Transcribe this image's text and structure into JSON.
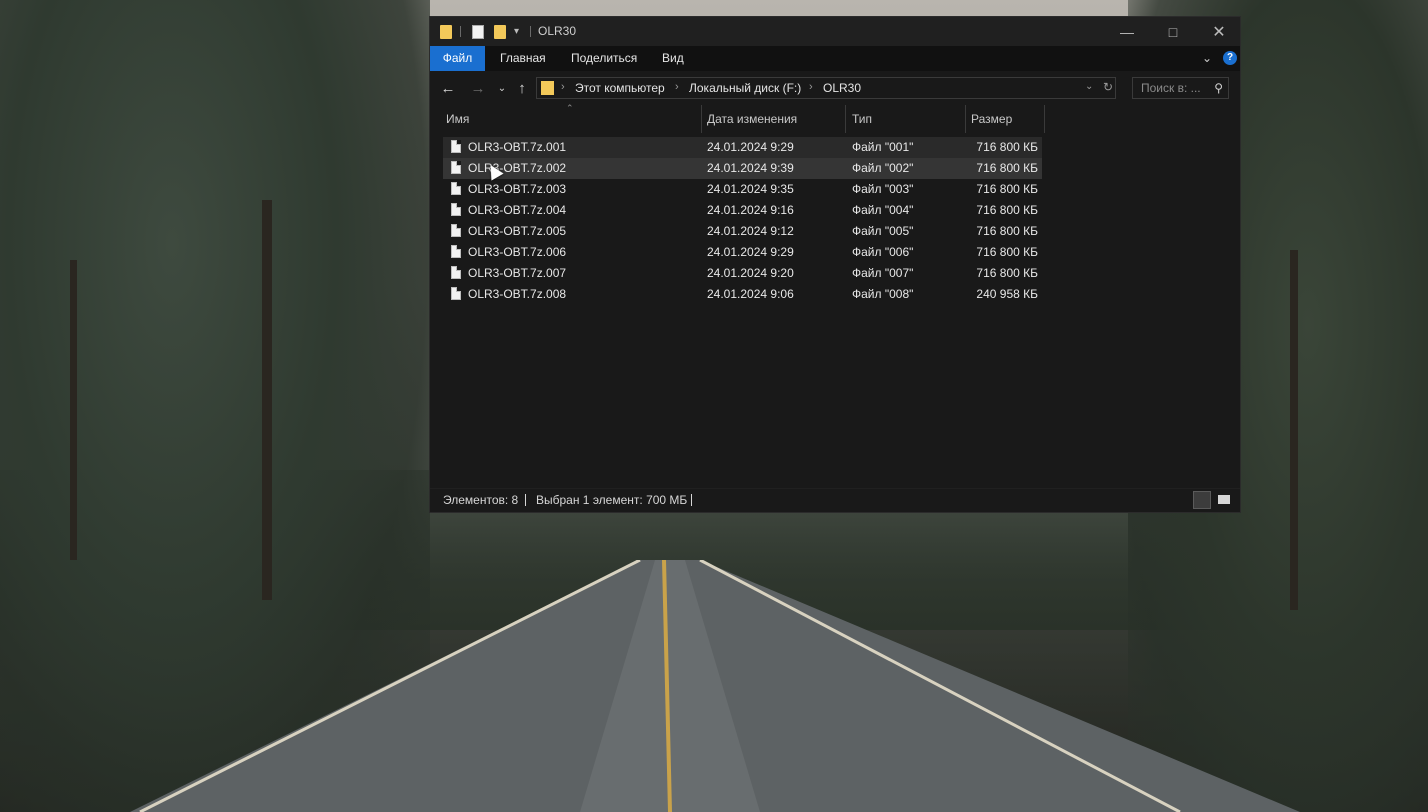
{
  "window": {
    "title": "OLR30",
    "menu": [
      "Файл",
      "Главная",
      "Поделиться",
      "Вид"
    ],
    "breadcrumb": [
      "Этот компьютер",
      "Локальный диск (F:)",
      "OLR30"
    ],
    "search_placeholder": "Поиск в: ...",
    "columns": {
      "name": "Имя",
      "date": "Дата изменения",
      "type": "Тип",
      "size": "Размер"
    },
    "files": [
      {
        "name": "OLR3-OBT.7z.001",
        "date": "24.01.2024 9:29",
        "type": "Файл \"001\"",
        "size": "716 800 КБ"
      },
      {
        "name": "OLR3-OBT.7z.002",
        "date": "24.01.2024 9:39",
        "type": "Файл \"002\"",
        "size": "716 800 КБ"
      },
      {
        "name": "OLR3-OBT.7z.003",
        "date": "24.01.2024 9:35",
        "type": "Файл \"003\"",
        "size": "716 800 КБ"
      },
      {
        "name": "OLR3-OBT.7z.004",
        "date": "24.01.2024 9:16",
        "type": "Файл \"004\"",
        "size": "716 800 КБ"
      },
      {
        "name": "OLR3-OBT.7z.005",
        "date": "24.01.2024 9:12",
        "type": "Файл \"005\"",
        "size": "716 800 КБ"
      },
      {
        "name": "OLR3-OBT.7z.006",
        "date": "24.01.2024 9:29",
        "type": "Файл \"006\"",
        "size": "716 800 КБ"
      },
      {
        "name": "OLR3-OBT.7z.007",
        "date": "24.01.2024 9:20",
        "type": "Файл \"007\"",
        "size": "716 800 КБ"
      },
      {
        "name": "OLR3-OBT.7z.008",
        "date": "24.01.2024 9:06",
        "type": "Файл \"008\"",
        "size": "240 958 КБ"
      }
    ],
    "status": {
      "count": "Элементов: 8",
      "selection": "Выбран 1 элемент: 700 МБ"
    }
  },
  "colors": {
    "accent": "#1a6fd0",
    "folder": "#f3c95a",
    "window_bg": "#191919"
  },
  "icons": [
    "folder-icon",
    "checklist-icon",
    "back-arrow-icon",
    "forward-arrow-icon",
    "up-arrow-icon",
    "refresh-icon",
    "search-icon",
    "help-icon",
    "file-icon",
    "details-view-icon",
    "tiles-view-icon"
  ]
}
